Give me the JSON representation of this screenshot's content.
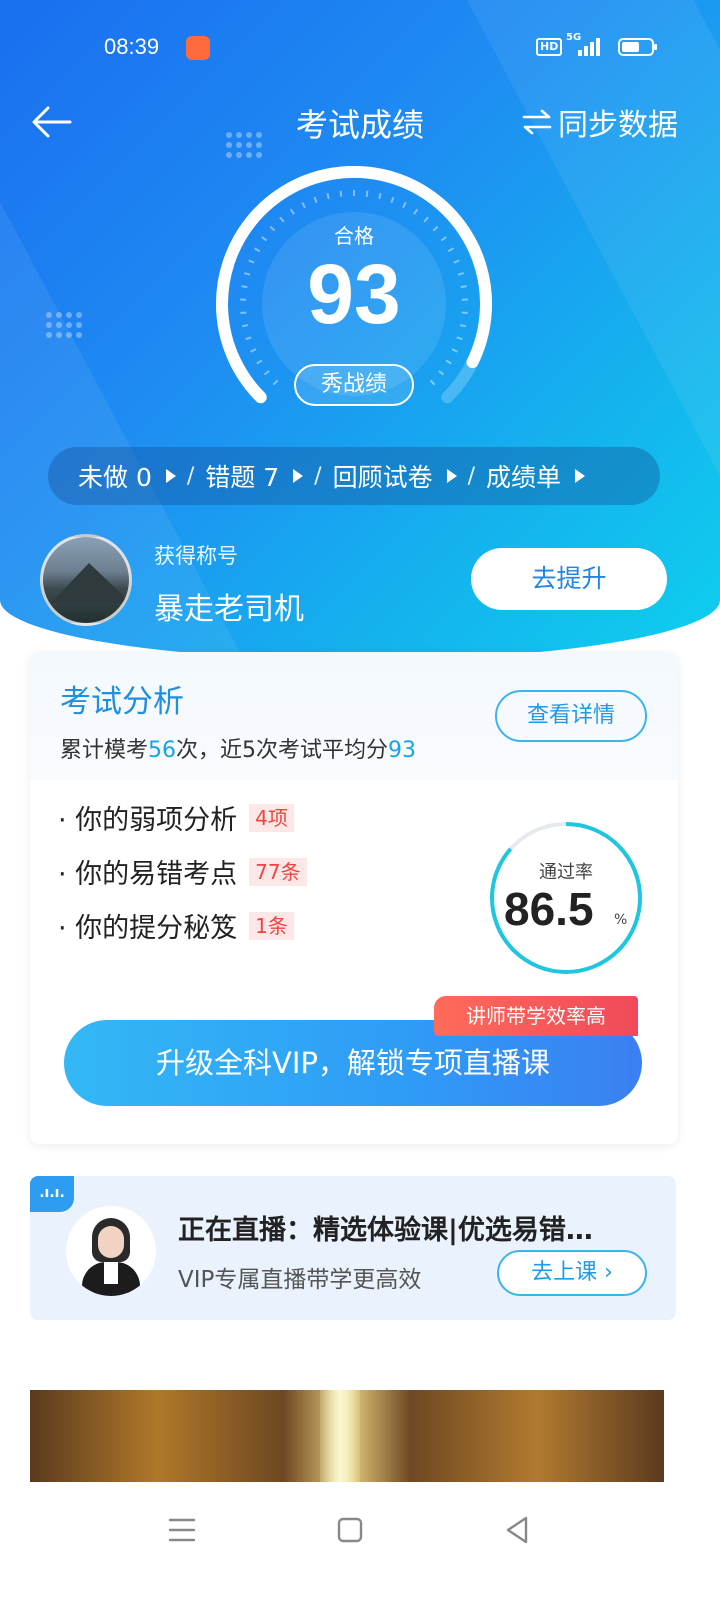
{
  "status": {
    "time": "08:39",
    "hd": "HD",
    "network": "5G",
    "battery_level": 0.6
  },
  "nav": {
    "title": "考试成绩",
    "sync_label": "同步数据"
  },
  "score": {
    "status": "合格",
    "value": "93",
    "show_label": "秀战绩"
  },
  "quickbar": {
    "items": [
      {
        "label": "未做 0"
      },
      {
        "label": "错题  7"
      },
      {
        "label": "回顾试卷"
      },
      {
        "label": "成绩单"
      }
    ],
    "separator": "/"
  },
  "profile": {
    "subtitle": "获得称号",
    "title": "暴走老司机",
    "button": "去提升"
  },
  "analysis": {
    "title": "考试分析",
    "summary_prefix": "累计模考",
    "exam_count": "56",
    "summary_mid": "次，近5次考试平均分",
    "avg_score": "93",
    "detail_button": "查看详情",
    "items": [
      {
        "label": "· 你的弱项分析",
        "tag": "4项"
      },
      {
        "label": "· 你的易错考点",
        "tag": "77条"
      },
      {
        "label": "· 你的提分秘笈",
        "tag": "1条"
      }
    ],
    "pass_rate_label": "通过率",
    "pass_rate": "86.5",
    "pass_rate_unit": "%",
    "pass_rate_fraction": 0.865,
    "vip_button": "升级全科VIP，解锁专项直播课",
    "vip_tag": "讲师带学效率高"
  },
  "live": {
    "badge": ".ı.ı.",
    "title": "正在直播：精选体验课|优选易错…",
    "subtitle": "VIP专属直播带学更高效",
    "button": "去上课"
  },
  "icons": {
    "back": "arrow-left-icon",
    "sync": "swap-icon",
    "menu": "menu-icon",
    "home": "square-icon",
    "back_nav": "triangle-back-icon"
  },
  "colors": {
    "accent": "#1f8fe0",
    "tag_red": "#ee4444",
    "ring": "#1ec6e0"
  }
}
